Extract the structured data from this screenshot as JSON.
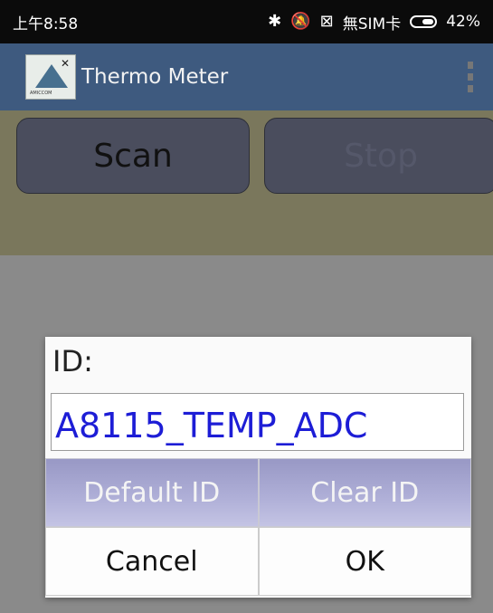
{
  "status_bar": {
    "time": "上午8:58",
    "icons": [
      "bluetooth-icon",
      "silent-icon",
      "sim-x-icon"
    ],
    "carrier": "無SIM卡",
    "battery_percent": "42%"
  },
  "action_bar": {
    "app_title": "Thermo Meter",
    "logo_text": "AMICCOM"
  },
  "main": {
    "scan_label": "Scan",
    "stop_label": "Stop"
  },
  "dialog": {
    "label": "ID:",
    "id_value": "A8115_TEMP_ADC",
    "default_id_label": "Default ID",
    "clear_id_label": "Clear ID",
    "cancel_label": "Cancel",
    "ok_label": "OK"
  },
  "colors": {
    "action_bar": "#3e5a7f",
    "panel": "#7a775c",
    "dialog_button": "#b0b0d8",
    "id_text": "#1d1dd6"
  }
}
